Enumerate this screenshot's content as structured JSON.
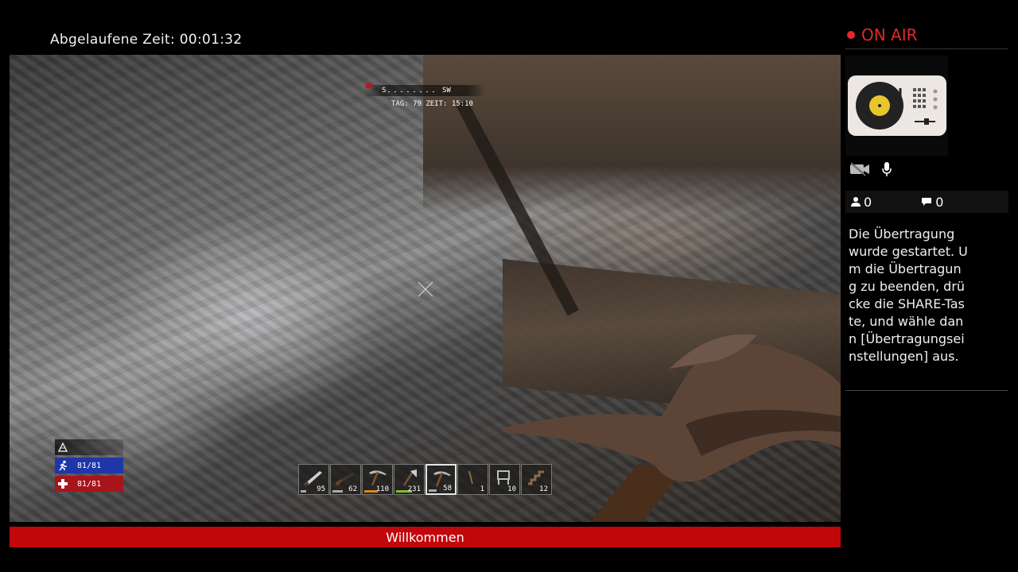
{
  "stream": {
    "elapsed_label": "Abgelaufene Zeit",
    "elapsed_sep": ":",
    "elapsed_time": "00:01:32",
    "onair_label": "ON AIR",
    "viewers": "0",
    "comments": "0",
    "message": "Die Übertragung wurde gestartet. Um die Übertragung zu beenden, drücke die SHARE-Taste, und wähle dann [Übertragungseinstellungen] aus.",
    "banner": "Willkommen"
  },
  "game": {
    "compass": {
      "left_dir": "S",
      "right_dir": "SW",
      "info": "TAG: 79  ZEIT: 15:10"
    },
    "stats": {
      "stamina": "81/81",
      "health": "81/81"
    },
    "toolbelt": [
      {
        "item": "knife-icon",
        "count": "95",
        "durability_color": "#aaaaaa",
        "durability": 0.2
      },
      {
        "item": "rifle-icon",
        "count": "62",
        "durability_color": "#aaaaaa",
        "durability": 0.4
      },
      {
        "item": "pickaxe-icon",
        "count": "110",
        "durability_color": "#e0851d",
        "durability": 0.5
      },
      {
        "item": "axe-icon",
        "count": "231",
        "durability_color": "#7fbf2a",
        "durability": 0.6
      },
      {
        "item": "pickaxe-icon",
        "count": "58",
        "durability_color": "#aaaaaa",
        "durability": 0.3,
        "active": true
      },
      {
        "item": "stick-icon",
        "count": "1"
      },
      {
        "item": "chair-icon",
        "count": "10"
      },
      {
        "item": "stairs-icon",
        "count": "12"
      }
    ]
  },
  "colors": {
    "onair": "#e2282d",
    "banner": "#c0070c",
    "stamina": "#1f36a8",
    "health": "#a8141c"
  }
}
